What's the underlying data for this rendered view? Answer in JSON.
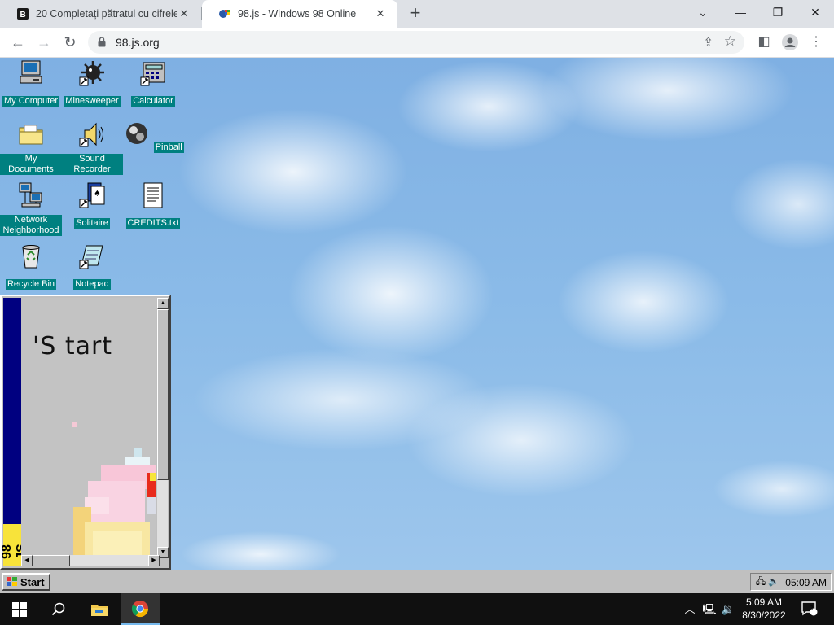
{
  "browser": {
    "tabs": [
      {
        "title": "20 Completați pătratul cu cifrele"
      },
      {
        "title": "98.js - Windows 98 Online"
      }
    ],
    "new_tab": "+",
    "url": "98.js.org"
  },
  "desktop": {
    "icons": [
      {
        "label": "My Computer"
      },
      {
        "label": "Minesweeper"
      },
      {
        "label": "Calculator"
      },
      {
        "label": "My Documents"
      },
      {
        "label": "Sound Recorder"
      },
      {
        "label": "Pinball"
      },
      {
        "label": "Network Neighborhood"
      },
      {
        "label": "Solitaire"
      },
      {
        "label": "CREDITS.txt"
      },
      {
        "label": "Recycle Bin"
      },
      {
        "label": "Notepad"
      }
    ],
    "app_window": {
      "art_text": "'S tart",
      "badge": "98 JS"
    }
  },
  "taskbar98": {
    "start_label": "Start",
    "clock": "05:09 AM"
  },
  "taskbar10": {
    "time": "5:09 AM",
    "date": "8/30/2022",
    "notification_count": "1"
  },
  "colors": {
    "desktop_label_bg": "#008080",
    "win98_gray": "#c0c0c0",
    "sky": "#8bbbe8"
  }
}
